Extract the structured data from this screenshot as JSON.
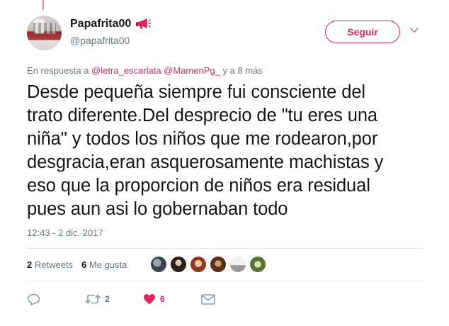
{
  "user": {
    "display_name": "Papafrita00",
    "handle": "@papafrita00",
    "badge_icon": "megaphone-icon"
  },
  "follow_button": {
    "label": "Seguir"
  },
  "reply_context": {
    "prefix": "En respuesta a",
    "mentions": [
      "@letra_escarlata",
      "@MamenPg_"
    ],
    "suffix": "y a 8 más"
  },
  "tweet": {
    "lines": [
      "Desde pequeña siempre fui consciente del",
      "trato diferente.Del desprecio de \"tu eres una",
      "niña\" y todos los niños que me rodearon,por",
      "desgracia,eran asquerosamente machistas y",
      "eso que la proporcion de niños era residual",
      "pues aun asi lo gobernaban todo"
    ],
    "timestamp": "12:43 - 2 dic. 2017"
  },
  "stats": {
    "retweets_count": "2",
    "retweets_label": "Retweets",
    "likes_count": "6",
    "likes_label": "Me gusta"
  },
  "actions": {
    "retweet_count": "2",
    "like_count": "6"
  },
  "colors": {
    "accent": "#e0245e",
    "secondary_text": "#657786",
    "primary_text": "#14171a"
  }
}
